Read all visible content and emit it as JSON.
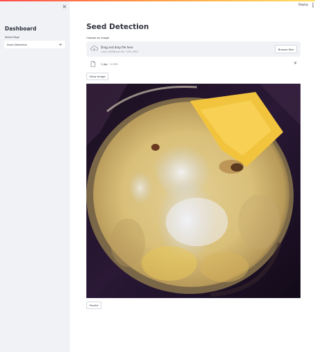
{
  "header": {
    "deploy_label": "Deploy"
  },
  "sidebar": {
    "close_icon": "×",
    "title": "Dashboard",
    "select_label": "Select Page",
    "select_value": "Seed Detection"
  },
  "main": {
    "title": "Seed Detection",
    "uploader": {
      "label": "Choose an image",
      "drop_text": "Drag and drop file here",
      "limit_text": "Limit 200MB per file • JPG, JPEG",
      "browse_label": "Browse files"
    },
    "file": {
      "name": "1.jpg",
      "size": "14.9KB",
      "remove_icon": "×"
    },
    "show_button_label": "Show Image",
    "predict_button_label": "Predict"
  },
  "colors": {
    "sidebar_bg": "#f0f2f6",
    "text": "#31333f",
    "accent_strip": "#ff4b4b"
  },
  "icons": [
    "close-icon",
    "chevron-down-icon",
    "more-vertical-icon",
    "cloud-upload-icon",
    "file-icon"
  ]
}
